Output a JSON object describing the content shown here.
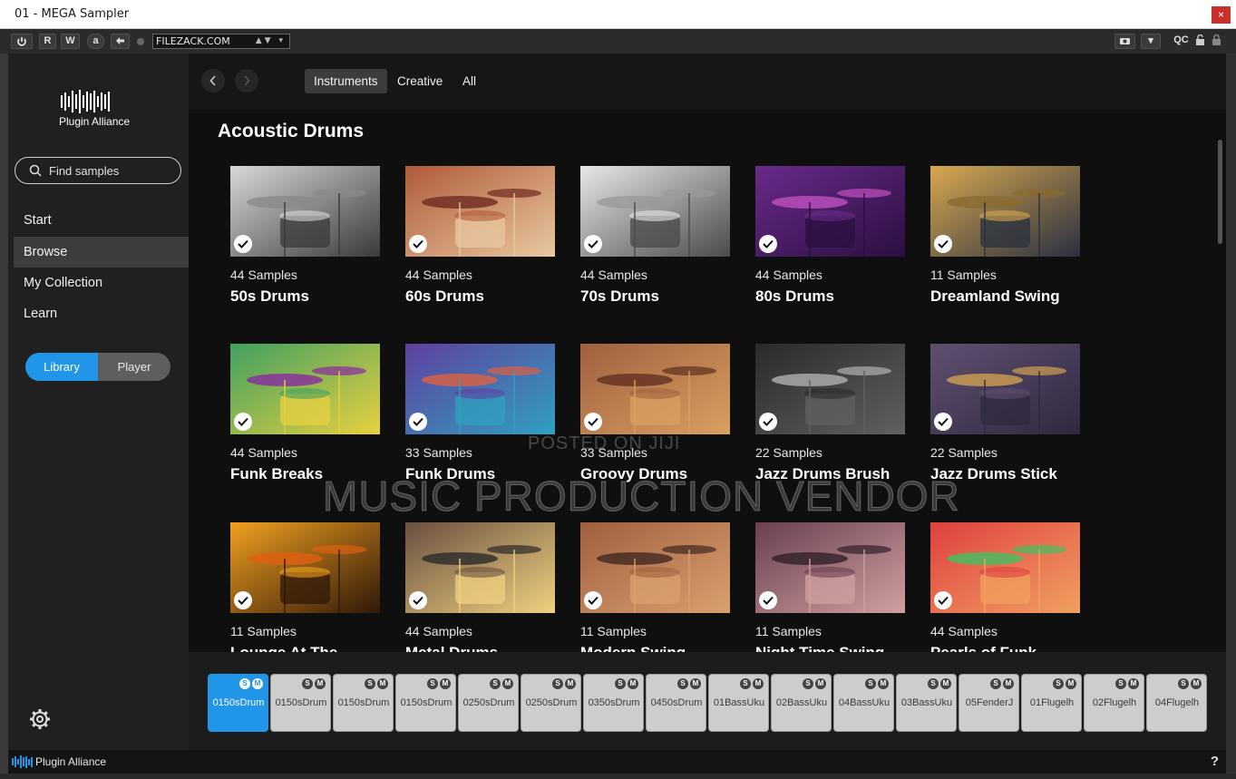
{
  "window": {
    "title": "01 - MEGA Sampler",
    "close_label": "×"
  },
  "host_toolbar": {
    "buttons": [
      "R",
      "W",
      "a"
    ],
    "preset": "FILEZACK.COM",
    "right_buttons": [
      "QC"
    ]
  },
  "sidebar": {
    "brand": "Plugin Alliance",
    "search_placeholder": "Find samples",
    "nav": [
      {
        "label": "Start",
        "active": false
      },
      {
        "label": "Browse",
        "active": true
      },
      {
        "label": "My Collection",
        "active": false
      },
      {
        "label": "Learn",
        "active": false
      }
    ],
    "toggle": {
      "library": "Library",
      "player": "Player",
      "selected": "Library"
    }
  },
  "top_nav": {
    "tabs": [
      {
        "label": "Instruments",
        "active": true
      },
      {
        "label": "Creative",
        "active": false
      },
      {
        "label": "All",
        "active": false
      }
    ]
  },
  "section_title": "Acoustic Drums",
  "cards": [
    {
      "count": "44 Samples",
      "name": "50s Drums"
    },
    {
      "count": "44 Samples",
      "name": "60s Drums"
    },
    {
      "count": "44 Samples",
      "name": "70s Drums"
    },
    {
      "count": "44 Samples",
      "name": "80s Drums"
    },
    {
      "count": "11 Samples",
      "name": "Dreamland Swing"
    },
    {
      "count": "44 Samples",
      "name": "Funk Breaks"
    },
    {
      "count": "33 Samples",
      "name": "Funk Drums"
    },
    {
      "count": "33 Samples",
      "name": "Groovy Drums"
    },
    {
      "count": "22 Samples",
      "name": "Jazz Drums Brush"
    },
    {
      "count": "22 Samples",
      "name": "Jazz Drums Stick"
    },
    {
      "count": "11 Samples",
      "name": "Lounge At The"
    },
    {
      "count": "44 Samples",
      "name": "Metal Drums"
    },
    {
      "count": "11 Samples",
      "name": "Modern Swing"
    },
    {
      "count": "11 Samples",
      "name": "Night Time Swing"
    },
    {
      "count": "44 Samples",
      "name": "Pearls of Funk"
    }
  ],
  "watermark": {
    "line1": "POSTED ON JIJI",
    "line2": "MUSIC PRODUCTION VENDOR"
  },
  "slots": [
    {
      "label": "0150sDrum",
      "active": true
    },
    {
      "label": "0150sDrum",
      "active": false
    },
    {
      "label": "0150sDrum",
      "active": false
    },
    {
      "label": "0150sDrum",
      "active": false
    },
    {
      "label": "0250sDrum",
      "active": false
    },
    {
      "label": "0250sDrum",
      "active": false
    },
    {
      "label": "0350sDrum",
      "active": false
    },
    {
      "label": "0450sDrum",
      "active": false
    },
    {
      "label": "01BassUku",
      "active": false
    },
    {
      "label": "02BassUku",
      "active": false
    },
    {
      "label": "04BassUku",
      "active": false
    },
    {
      "label": "03BassUku",
      "active": false
    },
    {
      "label": "05FenderJ",
      "active": false
    },
    {
      "label": "01Flugelh",
      "active": false
    },
    {
      "label": "02Flugelh",
      "active": false
    },
    {
      "label": "04Flugelh",
      "active": false
    }
  ],
  "slot_badges": {
    "solo": "S",
    "mute": "M"
  },
  "bottom_bar": {
    "brand": "Plugin Alliance",
    "help": "?"
  },
  "colors": {
    "accent": "#2196e8",
    "background": "#0f0f0f",
    "sidebar": "#202020"
  },
  "icons": [
    "power-icon",
    "undo-icon",
    "search-icon",
    "check-icon",
    "gear-icon",
    "chevron-left-icon",
    "chevron-right-icon",
    "camera-icon",
    "lock-icon",
    "help-icon"
  ]
}
